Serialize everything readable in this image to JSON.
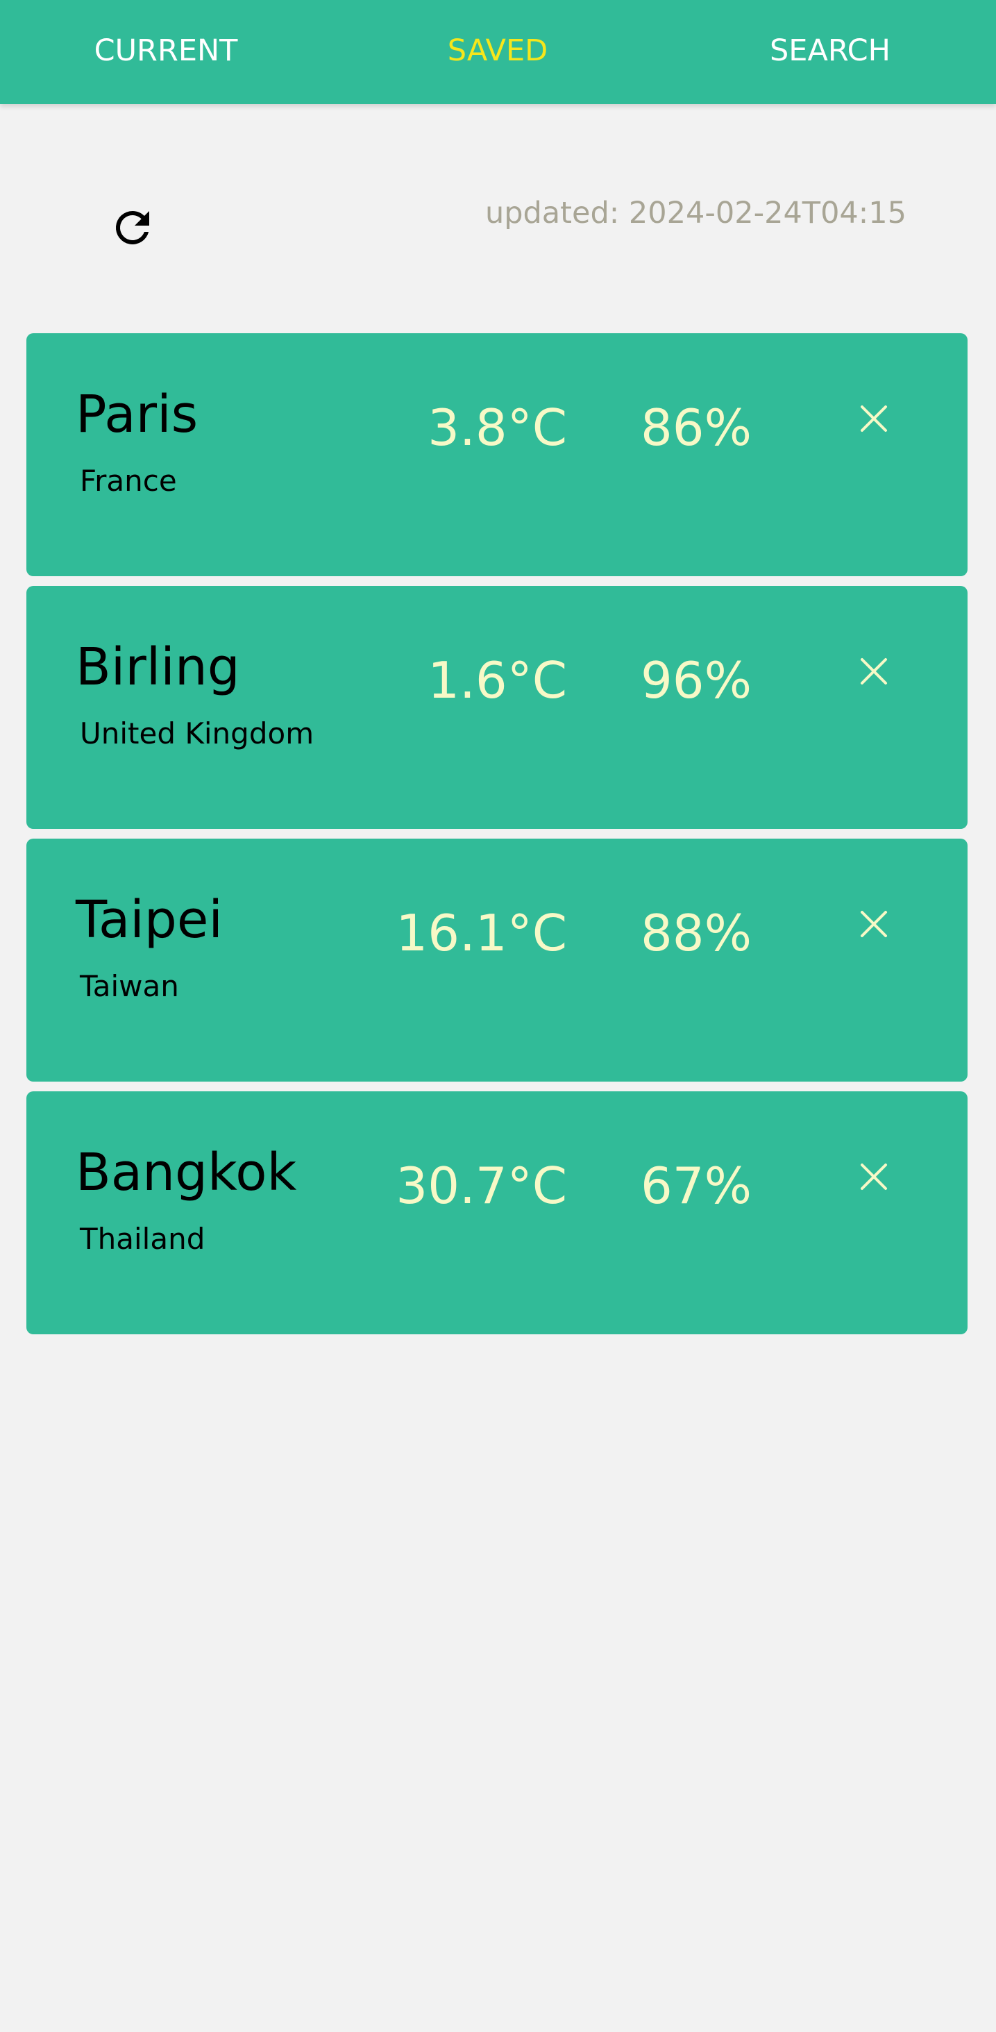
{
  "tabs": [
    {
      "label": "CURRENT",
      "active": false
    },
    {
      "label": "SAVED",
      "active": true
    },
    {
      "label": "SEARCH",
      "active": false
    }
  ],
  "colors": {
    "accent": "#31bb98",
    "active_tab": "#f6e61b",
    "value_text": "#f7f9c7",
    "updated_text": "#a8a595",
    "background": "#f2f2f2"
  },
  "toolbar": {
    "refresh_icon": "refresh-icon",
    "updated": "updated: 2024-02-24T04:15"
  },
  "saved_locations": [
    {
      "city": "Paris",
      "country": "France",
      "temperature": "3.8°C",
      "humidity": "86%",
      "remove_icon": "close-icon"
    },
    {
      "city": "Birling",
      "country": "United Kingdom",
      "temperature": "1.6°C",
      "humidity": "96%",
      "remove_icon": "close-icon"
    },
    {
      "city": "Taipei",
      "country": "Taiwan",
      "temperature": "16.1°C",
      "humidity": "88%",
      "remove_icon": "close-icon"
    },
    {
      "city": "Bangkok",
      "country": "Thailand",
      "temperature": "30.7°C",
      "humidity": "67%",
      "remove_icon": "close-icon"
    }
  ]
}
